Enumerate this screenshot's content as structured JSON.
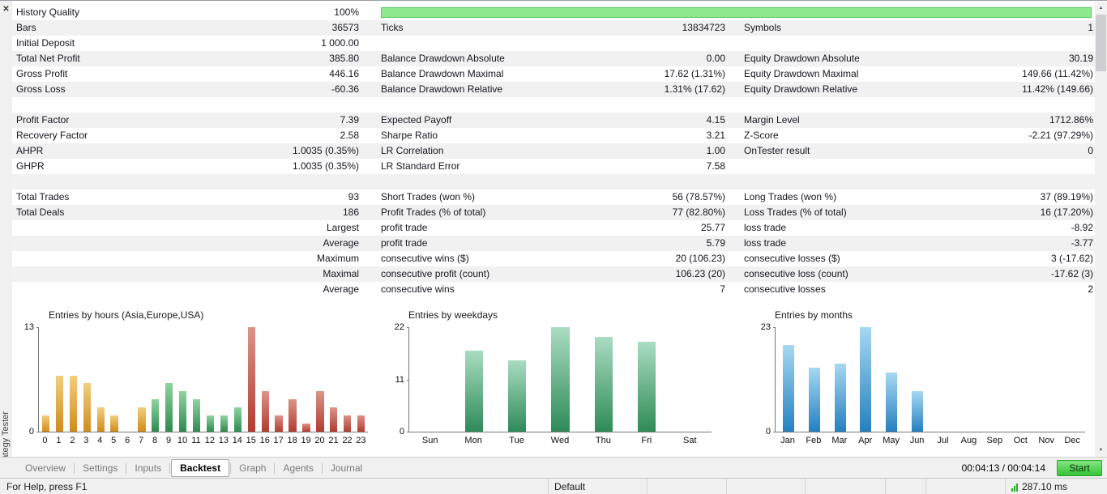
{
  "panel": {
    "title": "Strategy Tester"
  },
  "icons": {
    "close": "✕",
    "scroll_up": "▲",
    "scroll_down": "▼",
    "latency_signal": "signal-bars-icon"
  },
  "colors": {
    "progress_green": "#8fe98f",
    "start_button_top": "#84e584",
    "start_button_bottom": "#35c435",
    "row_stripe": "#f1f1f2"
  },
  "stats": {
    "rows": [
      {
        "c": [
          "History Quality",
          "100%",
          "",
          "",
          "",
          ""
        ],
        "progress": true
      },
      {
        "c": [
          "Bars",
          "36573",
          "Ticks",
          "13834723",
          "Symbols",
          "1"
        ]
      },
      {
        "c": [
          "Initial Deposit",
          "1 000.00",
          "",
          "",
          "",
          ""
        ]
      },
      {
        "c": [
          "Total Net Profit",
          "385.80",
          "Balance Drawdown Absolute",
          "0.00",
          "Equity Drawdown Absolute",
          "30.19"
        ]
      },
      {
        "c": [
          "Gross Profit",
          "446.16",
          "Balance Drawdown Maximal",
          "17.62 (1.31%)",
          "Equity Drawdown Maximal",
          "149.66 (11.42%)"
        ]
      },
      {
        "c": [
          "Gross Loss",
          "-60.36",
          "Balance Drawdown Relative",
          "1.31% (17.62)",
          "Equity Drawdown Relative",
          "11.42% (149.66)"
        ]
      },
      {
        "c": [
          "",
          "",
          "",
          "",
          "",
          ""
        ]
      },
      {
        "c": [
          "Profit Factor",
          "7.39",
          "Expected Payoff",
          "4.15",
          "Margin Level",
          "1712.86%"
        ]
      },
      {
        "c": [
          "Recovery Factor",
          "2.58",
          "Sharpe Ratio",
          "3.21",
          "Z-Score",
          "-2.21 (97.29%)"
        ]
      },
      {
        "c": [
          "AHPR",
          "1.0035 (0.35%)",
          "LR Correlation",
          "1.00",
          "OnTester result",
          "0"
        ]
      },
      {
        "c": [
          "GHPR",
          "1.0035 (0.35%)",
          "LR Standard Error",
          "7.58",
          "",
          ""
        ]
      },
      {
        "c": [
          "",
          "",
          "",
          "",
          "",
          ""
        ]
      },
      {
        "c": [
          "Total Trades",
          "93",
          "Short Trades (won %)",
          "56 (78.57%)",
          "Long Trades (won %)",
          "37 (89.19%)"
        ]
      },
      {
        "c": [
          "Total Deals",
          "186",
          "Profit Trades (% of total)",
          "77 (82.80%)",
          "Loss Trades (% of total)",
          "16 (17.20%)"
        ]
      },
      {
        "c": [
          "",
          "Largest",
          "profit trade",
          "25.77",
          "loss trade",
          "-8.92"
        ]
      },
      {
        "c": [
          "",
          "Average",
          "profit trade",
          "5.79",
          "loss trade",
          "-3.77"
        ]
      },
      {
        "c": [
          "",
          "Maximum",
          "consecutive wins ($)",
          "20 (106.23)",
          "consecutive losses ($)",
          "3 (-17.62)"
        ]
      },
      {
        "c": [
          "",
          "Maximal",
          "consecutive profit (count)",
          "106.23 (20)",
          "consecutive loss (count)",
          "-17.62 (3)"
        ]
      },
      {
        "c": [
          "",
          "Average",
          "consecutive wins",
          "7",
          "consecutive losses",
          "2"
        ]
      }
    ]
  },
  "chart_data": [
    {
      "type": "bar",
      "title": "Entries by hours (Asia,Europe,USA)",
      "categories": [
        "0",
        "1",
        "2",
        "3",
        "4",
        "5",
        "6",
        "7",
        "8",
        "9",
        "10",
        "11",
        "12",
        "13",
        "14",
        "15",
        "16",
        "17",
        "18",
        "19",
        "20",
        "21",
        "22",
        "23"
      ],
      "values": [
        2,
        7,
        7,
        6,
        3,
        2,
        0,
        3,
        4,
        6,
        5,
        4,
        2,
        2,
        3,
        13,
        5,
        2,
        4,
        1,
        5,
        3,
        2,
        2
      ],
      "ylim": [
        0,
        13
      ],
      "yticks": [
        13,
        0
      ],
      "groups": [
        "asia",
        "asia",
        "asia",
        "asia",
        "asia",
        "asia",
        "asia",
        "asia",
        "europe",
        "europe",
        "europe",
        "europe",
        "europe",
        "europe",
        "europe",
        "usa",
        "usa",
        "usa",
        "usa",
        "usa",
        "usa",
        "usa",
        "usa",
        "usa"
      ],
      "group_colors": {
        "asia": [
          "#f2cf80",
          "#cf8c1a"
        ],
        "europe": [
          "#90d3a0",
          "#2e8b50"
        ],
        "usa": [
          "#dc9488",
          "#b23c30"
        ]
      },
      "bar_width_pct": 55,
      "grid": false,
      "legend": "none"
    },
    {
      "type": "bar",
      "title": "Entries by weekdays",
      "categories": [
        "Sun",
        "Mon",
        "Tue",
        "Wed",
        "Thu",
        "Fri",
        "Sat"
      ],
      "values": [
        0,
        17,
        15,
        22,
        20,
        19,
        0
      ],
      "ylim": [
        0,
        22
      ],
      "yticks": [
        22,
        11,
        0
      ],
      "bar_color": [
        "#aadcc2",
        "#2e8b57"
      ],
      "bar_width_pct": 42,
      "grid": false,
      "legend": "none"
    },
    {
      "type": "bar",
      "title": "Entries by months",
      "categories": [
        "Jan",
        "Feb",
        "Mar",
        "Apr",
        "May",
        "Jun",
        "Jul",
        "Aug",
        "Sep",
        "Oct",
        "Nov",
        "Dec"
      ],
      "values": [
        19,
        14,
        15,
        23,
        13,
        9,
        0,
        0,
        0,
        0,
        0,
        0
      ],
      "ylim": [
        0,
        23
      ],
      "yticks": [
        23,
        0
      ],
      "bar_color": [
        "#a6d8f2",
        "#2580c0"
      ],
      "bar_width_pct": 44,
      "grid": false,
      "legend": "none"
    }
  ],
  "tabbar": {
    "tabs": [
      {
        "label": "Overview",
        "active": false
      },
      {
        "label": "Settings",
        "active": false
      },
      {
        "label": "Inputs",
        "active": false
      },
      {
        "label": "Backtest",
        "active": true
      },
      {
        "label": "Graph",
        "active": false
      },
      {
        "label": "Agents",
        "active": false
      },
      {
        "label": "Journal",
        "active": false
      }
    ],
    "timer": "00:04:13 / 00:04:14",
    "start_label": "Start"
  },
  "statusbar": {
    "help": "For Help, press F1",
    "profile": "Default",
    "latency": "287.10 ms"
  }
}
